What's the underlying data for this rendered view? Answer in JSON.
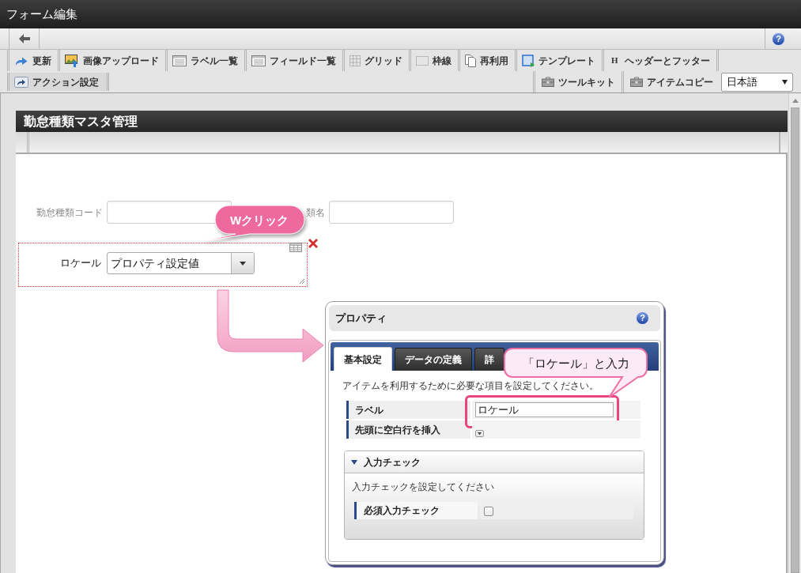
{
  "window": {
    "title": "フォーム編集"
  },
  "nav_bar": {
    "help": "?"
  },
  "toolbar": {
    "row_1": [
      {
        "label": "更新"
      },
      {
        "label": "画像アップロード"
      },
      {
        "label": "ラベル一覧"
      },
      {
        "label": "フィールド一覧"
      },
      {
        "label": "グリッド"
      },
      {
        "label": "枠線"
      },
      {
        "label": "再利用"
      },
      {
        "label": "テンプレート"
      },
      {
        "label": "ヘッダーとフッター",
        "glyph": "H"
      }
    ],
    "row_2_left": [
      {
        "label": "アクション設定",
        "highlighted": true
      }
    ],
    "row_2_right": [
      {
        "label": "ツールキット"
      },
      {
        "label": "アイテムコピー"
      }
    ],
    "language_select": {
      "value": "日本語"
    }
  },
  "form": {
    "title": "勤怠種類マスタ管理",
    "rows": [
      {
        "fields": [
          {
            "kind": "text",
            "label": "勤怠種類コード",
            "selected": false
          },
          {
            "kind": "text",
            "label": "類名",
            "selected": false
          }
        ]
      },
      {
        "fields": [
          {
            "kind": "select",
            "label": "ロケール",
            "value": "プロパティ設定値",
            "selected": true
          }
        ]
      }
    ]
  },
  "property_dialog": {
    "title": "プロパティ",
    "help": "?",
    "tabs": [
      {
        "label": "基本設定",
        "selected": true
      },
      {
        "label": "データの定義",
        "selected": false
      },
      {
        "label": "詳",
        "selected": false
      }
    ],
    "description": "アイテムを利用するために必要な項目を設定してください。",
    "rows": [
      {
        "kind": "text",
        "label": "ラベル",
        "value": "ロケール",
        "highlighted": true
      },
      {
        "kind": "toggle",
        "label": "先頭に空白行を挿入",
        "highlighted": false
      }
    ],
    "section": {
      "title": "入力チェック",
      "expanded": true,
      "description": "入力チェックを設定してください",
      "rows": [
        {
          "kind": "checkbox",
          "label": "必須入力チェック",
          "checked": false
        }
      ]
    }
  },
  "annotations": [
    {
      "kind": "filled",
      "text": "Wクリック"
    },
    {
      "kind": "outlined",
      "text": "「ロケール」と入力"
    }
  ]
}
